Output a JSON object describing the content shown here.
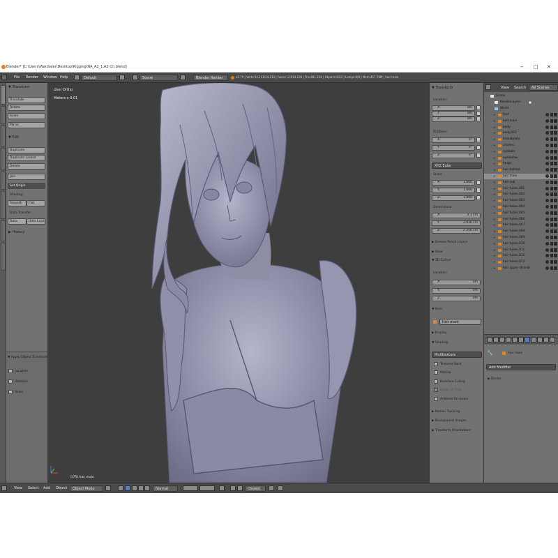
{
  "window": {
    "title": "Blender* [C:\\Users\\Wardialer\\Desktop\\Rigging\\NA_A2_1.A2 (2).blend]",
    "min": "–",
    "max": "□",
    "close": "✕"
  },
  "top_menu": {
    "items": [
      "File",
      "Render",
      "Window",
      "Help"
    ],
    "layout": "Default",
    "scene": "Scene",
    "engine": "Blender Render",
    "stats": "v2.79 | Verts:14,213/14,213 | Faces:12,914,236 | Tris:461,218 | Objects:0/22 | Lamps:0/0 | Mem:417.76M | hair main"
  },
  "toolshelf": {
    "transform_header": "Transform",
    "transform_buttons": [
      "Translate",
      "Rotate",
      "Scale",
      "Mirror"
    ],
    "edit_header": "Edit",
    "edit_buttons": [
      "Duplicate",
      "Duplicate Linked",
      "Delete",
      "Join"
    ],
    "set_origin": "Set Origin",
    "shading_label": "Shading:",
    "smooth": "Smooth",
    "flat": "Flat",
    "data_transfer_label": "Data Transfer:",
    "data": "Data",
    "data_layout": "Data Lays",
    "history_header": "History",
    "operator_header": "Apply Object Transform",
    "operator_options": [
      "Location",
      "Rotation",
      "Scale"
    ]
  },
  "viewport": {
    "view_name": "User Ortho",
    "meters": "Meters x 0.01",
    "object_label": "(175) hair main"
  },
  "properties": {
    "transform_header": "Transform",
    "location_label": "Location:",
    "location": [
      {
        "axis": "X:",
        "value": "0m"
      },
      {
        "axis": "Y:",
        "value": "0m"
      },
      {
        "axis": "Z:",
        "value": "0m"
      }
    ],
    "rotation_label": "Rotation:",
    "rotation": [
      {
        "axis": "X:",
        "value": "0°"
      },
      {
        "axis": "Y:",
        "value": "0°"
      },
      {
        "axis": "Z:",
        "value": "0°"
      }
    ],
    "rotation_mode": "XYZ Euler",
    "scale_label": "Scale:",
    "scale": [
      {
        "axis": "X:",
        "value": "1.000"
      },
      {
        "axis": "Y:",
        "value": "1.000"
      },
      {
        "axis": "Z:",
        "value": "1.000"
      }
    ],
    "dimensions_label": "Dimensions:",
    "dimensions": [
      {
        "axis": "X:",
        "value": "2.1 cm"
      },
      {
        "axis": "Y:",
        "value": "2.936 cm"
      },
      {
        "axis": "Z:",
        "value": "2.356 cm"
      }
    ],
    "grease_pencil": "Grease Pencil Layers",
    "view": "View",
    "cursor_header": "3D Cursor",
    "cursor_location_label": "Location:",
    "cursor": [
      {
        "axis": "X:",
        "value": "0m"
      },
      {
        "axis": "Y:",
        "value": "0m"
      },
      {
        "axis": "Z:",
        "value": "0m"
      }
    ],
    "item_header": "Item",
    "item_name": "hair main",
    "display": "Display",
    "shading_header": "Shading",
    "shading_mode": "Multitexture",
    "shading_options": [
      "Textured Solid",
      "Matcap",
      "Backface Culling",
      "Depth Of Field",
      "Ambient Occlusion"
    ],
    "motion_tracking": "Motion Tracking",
    "background_images": "Background Images",
    "transform_orientations": "Transform Orientations"
  },
  "outliner": {
    "view_label": "View",
    "search_label": "Search",
    "filter": "All Scenes",
    "scene_name": "Scene",
    "render_layers": "RenderLayers",
    "world": "World",
    "items": [
      "foot",
      "belt main",
      "body",
      "body.001",
      "breastplate",
      "charms",
      "eyeballs",
      "eyelashes",
      "fangs",
      "hair helmet",
      "hair main",
      "hair sub",
      "hair tubes.001",
      "hair tubes.002",
      "hair tubes.003",
      "hair tubes.004",
      "hair tubes.005",
      "hair tubes.006",
      "hair tubes.007",
      "hair tubes.008",
      "hair tubes.009",
      "hair tubes.010",
      "hair tubes.011",
      "hair tubes.012",
      "hair tubes.013",
      "hair upper strands"
    ],
    "selected_item": "hair main"
  },
  "modifiers": {
    "object_name": "hair main",
    "add_modifier": "Add Modifier",
    "modifier": "Decim"
  },
  "bottom_bar": {
    "menus": [
      "View",
      "Select",
      "Add",
      "Object"
    ],
    "mode": "Object Mode",
    "pivot": "Normal",
    "snap": "Closest"
  },
  "colors": {
    "viewport_bg": "#3e3e3e",
    "panel_bg": "#727272",
    "header_bg": "#4a4a4a",
    "mesh": "#9a9ab4",
    "selected_row": "#8f8f8f",
    "accent": "#e08a2a"
  }
}
